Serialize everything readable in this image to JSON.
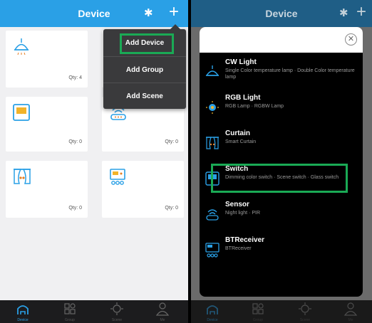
{
  "left": {
    "title": "Device",
    "menu": [
      "Add Device",
      "Add Group",
      "Add Scene"
    ],
    "cards": [
      {
        "icon": "ceiling-lamp-icon",
        "qty": "Qty: 4"
      },
      {
        "icon": "switch-icon",
        "qty": "Qty: 0"
      },
      {
        "icon": "sensor-icon",
        "qty": "Qty: 0"
      },
      {
        "icon": "curtain-icon",
        "qty": "Qty: 0"
      },
      {
        "icon": "receiver-icon",
        "qty": "Qty: 0"
      }
    ]
  },
  "right": {
    "title": "Device",
    "items": [
      {
        "title": "CW Light",
        "sub": "Single Color temperature lamp · Double Color temperature lamp"
      },
      {
        "title": "RGB Light",
        "sub": "RGB Lamp · RGBW Lamp"
      },
      {
        "title": "Curtain",
        "sub": "Smart Curtain"
      },
      {
        "title": "Switch",
        "sub": "Dimming color switch · Scene switch · Glass switch"
      },
      {
        "title": "Sensor",
        "sub": "Night light · PIR"
      },
      {
        "title": "BTReceiver",
        "sub": "BTReceiver"
      }
    ]
  },
  "tabs": [
    "Device",
    "Group",
    "Scene",
    "Me"
  ],
  "colors": {
    "accent": "#2aa0e6",
    "highlight": "#1aaa55"
  }
}
